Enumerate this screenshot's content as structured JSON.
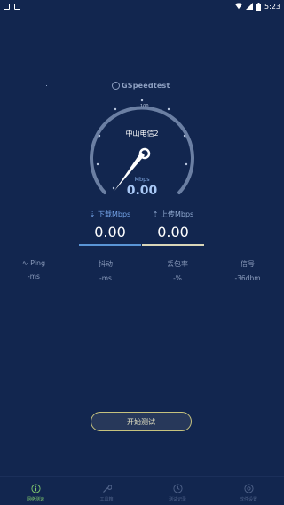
{
  "status_bar": {
    "time": "5:23"
  },
  "brand": {
    "name": "GSpeedtest"
  },
  "gauge": {
    "isp": "中山电信2",
    "unit": "Mbps",
    "value": "0.00"
  },
  "download": {
    "label": "下载Mbps",
    "value": "0.00"
  },
  "upload": {
    "label": "上传Mbps",
    "value": "0.00"
  },
  "stats": {
    "ping": {
      "label": "Ping",
      "value": "-ms"
    },
    "jitter": {
      "label": "抖动",
      "value": "-ms"
    },
    "loss": {
      "label": "丢包率",
      "value": "-%"
    },
    "signal": {
      "label": "信号",
      "value": "-36dbm"
    }
  },
  "start_button": {
    "label": "开始测试"
  },
  "bottom_nav": {
    "items": [
      {
        "label": "网络测速",
        "icon": "info-circle-icon",
        "active": true
      },
      {
        "label": "工具箱",
        "icon": "wrench-icon",
        "active": false
      },
      {
        "label": "测试记录",
        "icon": "clock-icon",
        "active": false
      },
      {
        "label": "软件设置",
        "icon": "settings-icon",
        "active": false
      }
    ]
  },
  "colors": {
    "background": "#12264f",
    "accent_download": "#5a95d6",
    "accent_upload": "#d9d6b8",
    "active_nav": "#7ec86e"
  }
}
